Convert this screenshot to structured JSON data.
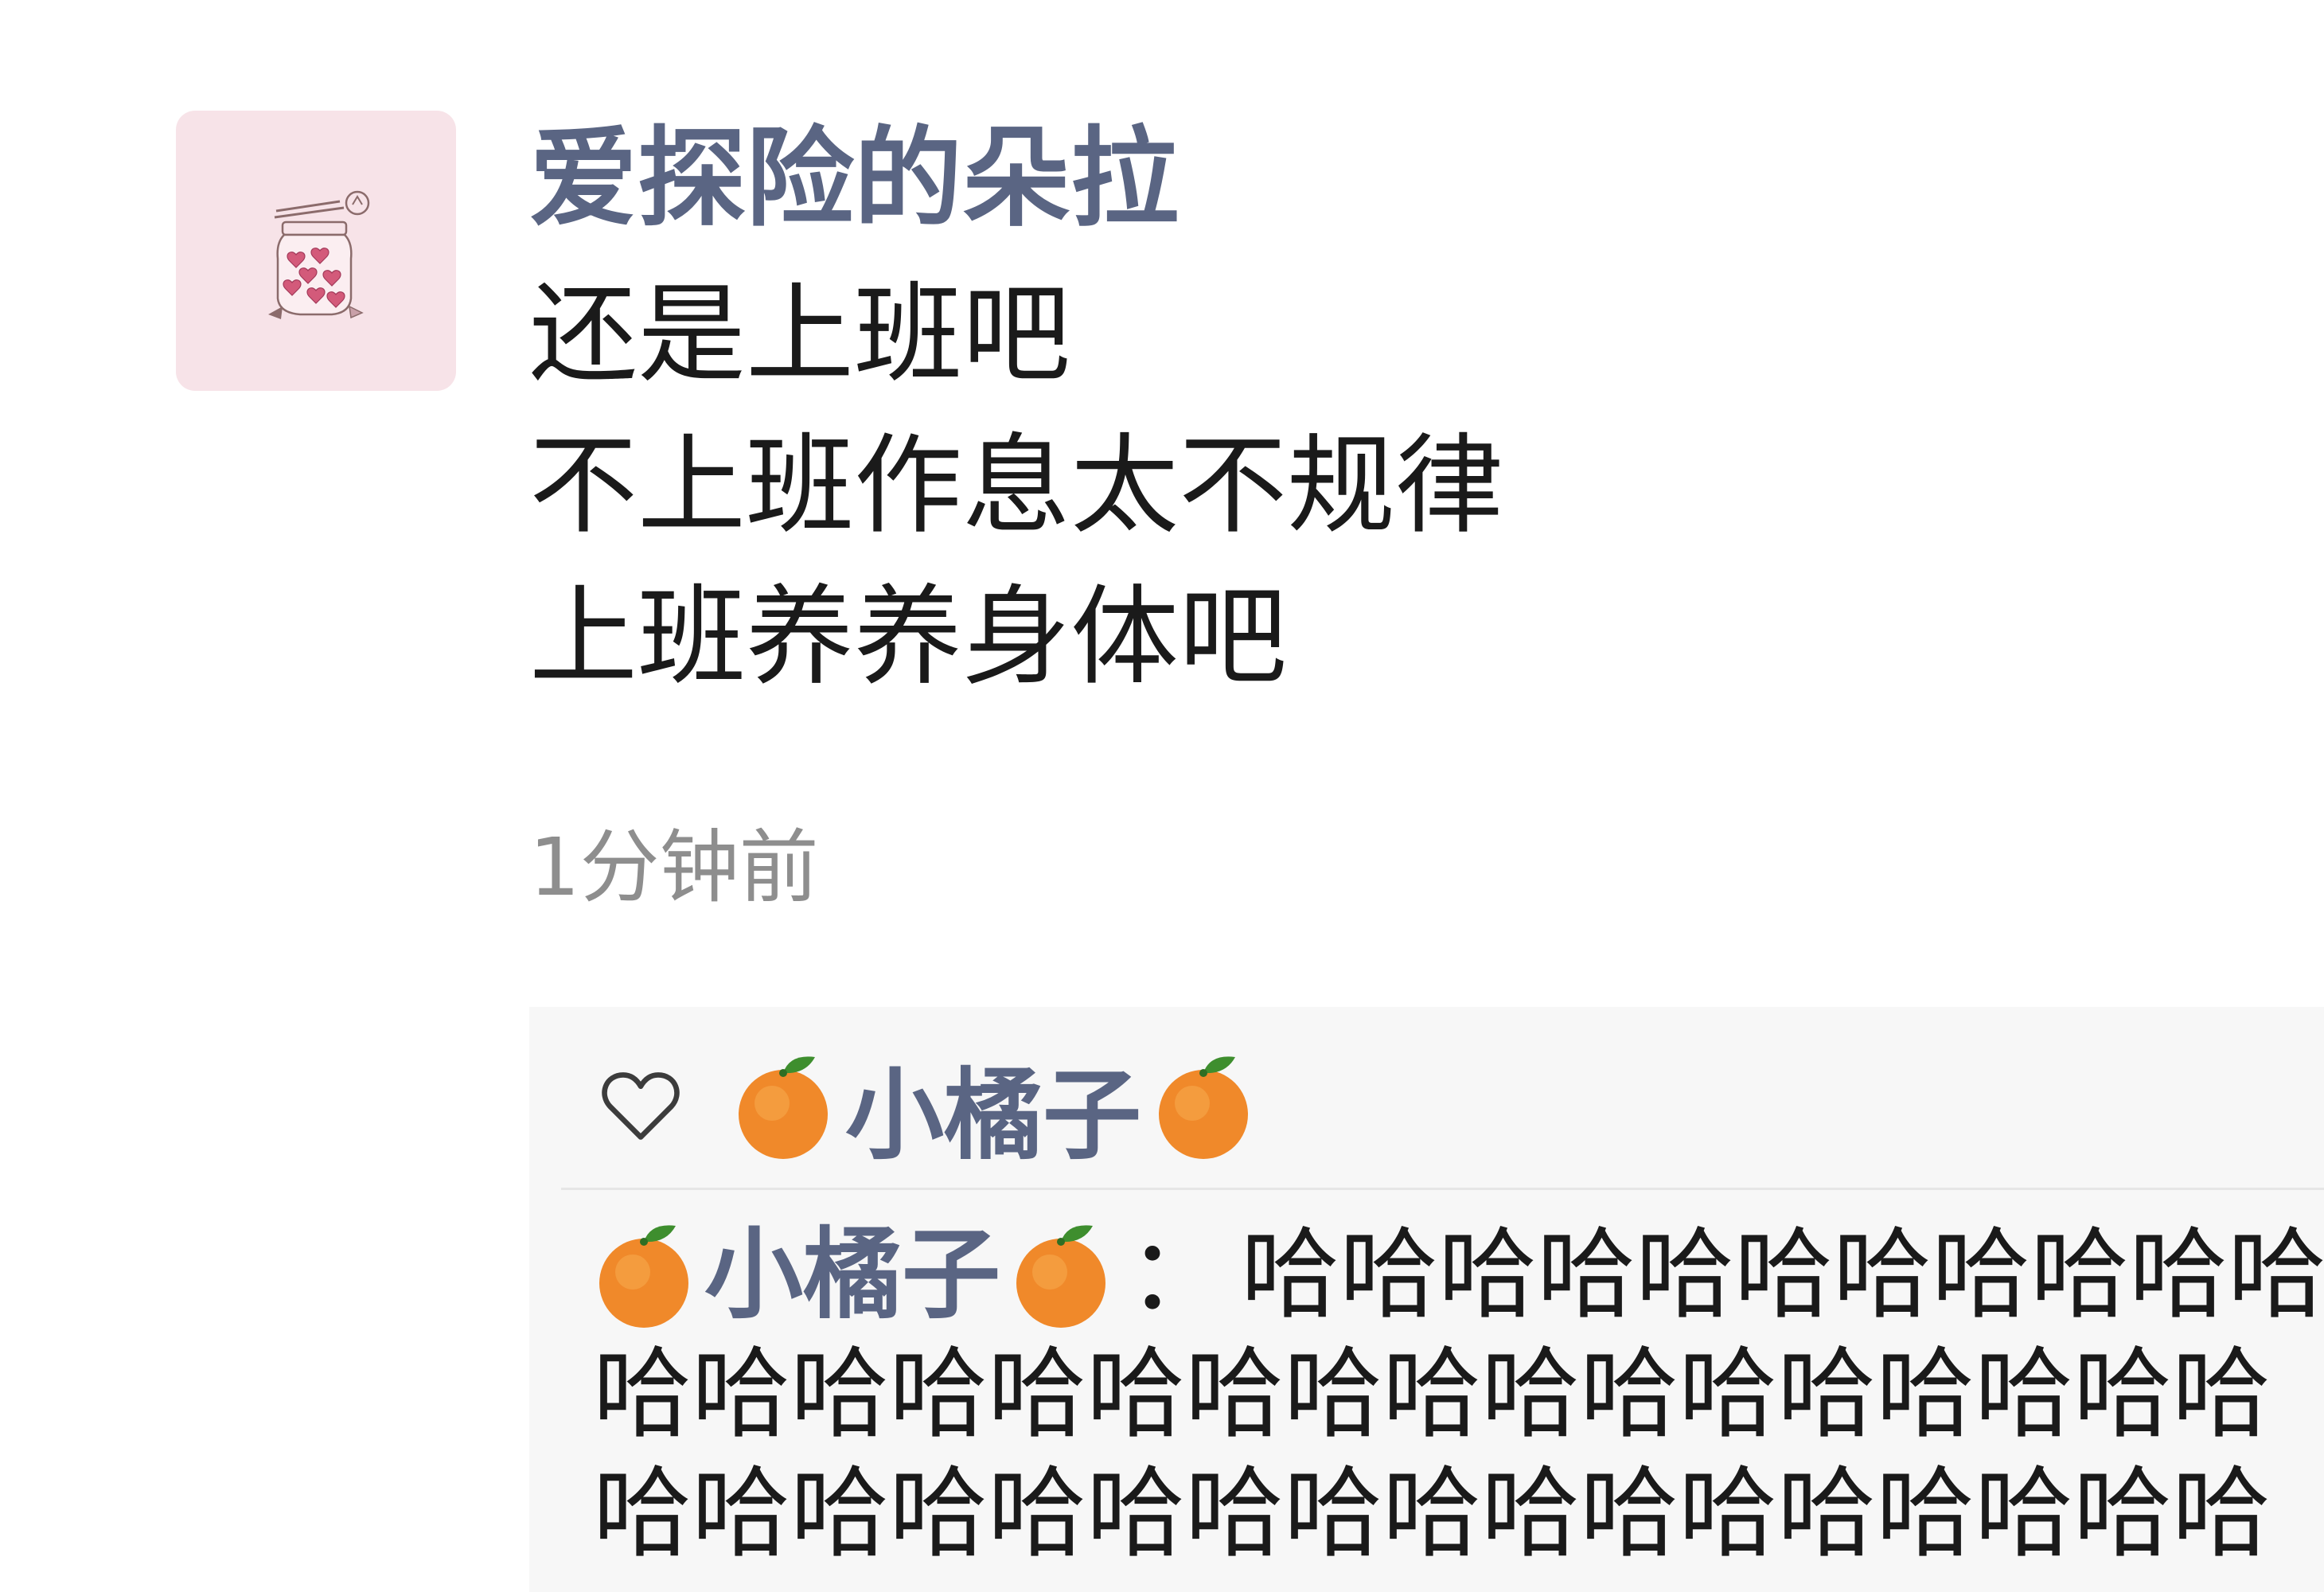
{
  "post": {
    "username": "爱探险的朵拉",
    "content_lines": [
      "还是上班吧",
      "不上班作息太不规律",
      "上班养养身体吧"
    ],
    "time": "1分钟前"
  },
  "likes": {
    "liker_name": "小橘子"
  },
  "comment": {
    "author": "小橘子",
    "separator": "：",
    "text_lines": [
      "哈哈哈哈哈哈哈哈哈哈哈",
      "哈哈哈哈哈哈哈哈哈哈哈哈哈哈哈哈哈",
      "哈哈哈哈哈哈哈哈哈哈哈哈哈哈哈哈哈"
    ]
  },
  "icons": {
    "heart": "heart-outline-icon",
    "orange": "tangerine-emoji-icon",
    "avatar": "jar-of-hearts-illustration"
  },
  "colors": {
    "username": "#5a6583",
    "text": "#1a1a1a",
    "time": "#8e8e8e",
    "reply_bg": "#f7f7f7",
    "avatar_bg": "#f7e3e8"
  }
}
